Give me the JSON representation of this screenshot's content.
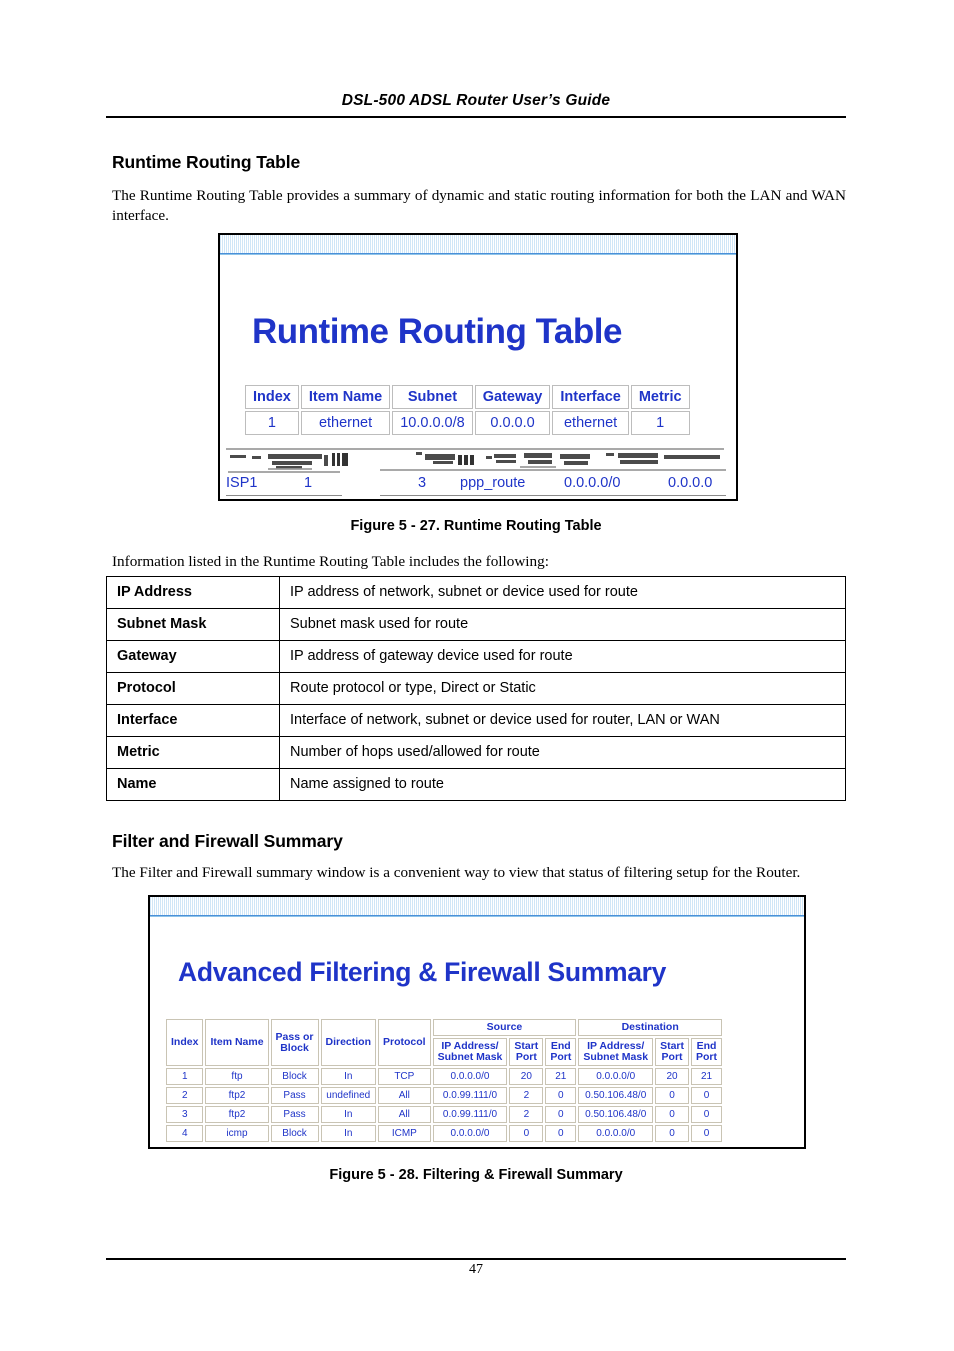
{
  "document": {
    "running_head": "DSL-500 ADSL Router User’s Guide",
    "page_number": "47"
  },
  "sections": {
    "routing": {
      "heading": "Runtime Routing Table",
      "intro": "The Runtime Routing Table provides a summary of dynamic and static routing information for both the LAN and WAN interface.",
      "figure_caption": "Figure 5 - 27. Runtime Routing Table",
      "list_intro": "Information listed in the Runtime Routing Table includes the following:"
    },
    "firewall": {
      "heading": "Filter and Firewall Summary",
      "intro": "The Filter and Firewall summary window is a convenient way to view that status of filtering setup for the Router.",
      "figure_caption": "Figure 5 - 28. Filtering & Firewall Summary"
    }
  },
  "figure_runtime_routing": {
    "title": "Runtime Routing Table",
    "title_color": "#1f34c8",
    "headers": [
      "Index",
      "Item Name",
      "Subnet",
      "Gateway",
      "Interface",
      "Metric"
    ],
    "rows": [
      [
        "1",
        "ethernet",
        "10.0.0.0/8",
        "0.0.0.0",
        "ethernet",
        "1"
      ]
    ],
    "artifact_row": {
      "note": "scan artifact — partially garbled row",
      "fragments": [
        "ISP1",
        "1",
        "3",
        "ppp_route",
        "0.0.0.0/0",
        "0.0.0.0"
      ]
    }
  },
  "definition_table": {
    "rows": [
      {
        "term": "IP Address",
        "definition": "IP address of network, subnet or device used for route"
      },
      {
        "term": "Subnet Mask",
        "definition": "Subnet mask used for route"
      },
      {
        "term": "Gateway",
        "definition": "IP address of gateway device used for route"
      },
      {
        "term": "Protocol",
        "definition": "Route protocol or type, Direct or Static"
      },
      {
        "term": "Interface",
        "definition": "Interface of network, subnet or device used for router, LAN or WAN"
      },
      {
        "term": "Metric",
        "definition": "Number of hops used/allowed for route"
      },
      {
        "term": "Name",
        "definition": "Name assigned to route"
      }
    ]
  },
  "figure_firewall_summary": {
    "title": "Advanced Filtering & Firewall Summary",
    "title_color": "#1f34c8",
    "group_headers": {
      "source": "Source",
      "destination": "Destination"
    },
    "headers": [
      "Index",
      "Item Name",
      "Pass or Block",
      "Direction",
      "Protocol",
      "IP Address/ Subnet Mask",
      "Start Port",
      "End Port",
      "IP Address/ Subnet Mask",
      "Start Port",
      "End Port"
    ],
    "header_lines": {
      "index": "Index",
      "item_name": "Item Name",
      "pass_or_block_1": "Pass or",
      "pass_or_block_2": "Block",
      "direction": "Direction",
      "protocol": "Protocol",
      "src_ip_1": "IP Address/",
      "src_ip_2": "Subnet Mask",
      "src_start_1": "Start",
      "src_start_2": "Port",
      "src_end_1": "End",
      "src_end_2": "Port",
      "dst_ip_1": "IP Address/",
      "dst_ip_2": "Subnet Mask",
      "dst_start_1": "Start",
      "dst_start_2": "Port",
      "dst_end_1": "End",
      "dst_end_2": "Port"
    },
    "rows": [
      [
        "1",
        "ftp",
        "Block",
        "In",
        "TCP",
        "0.0.0.0/0",
        "20",
        "21",
        "0.0.0.0/0",
        "20",
        "21"
      ],
      [
        "2",
        "ftp2",
        "Pass",
        "undefined",
        "All",
        "0.0.99.111/0",
        "2",
        "0",
        "0.50.106.48/0",
        "0",
        "0"
      ],
      [
        "3",
        "ftp2",
        "Pass",
        "In",
        "All",
        "0.0.99.111/0",
        "2",
        "0",
        "0.50.106.48/0",
        "0",
        "0"
      ],
      [
        "4",
        "icmp",
        "Block",
        "In",
        "ICMP",
        "0.0.0.0/0",
        "0",
        "0",
        "0.0.0.0/0",
        "0",
        "0"
      ]
    ]
  }
}
